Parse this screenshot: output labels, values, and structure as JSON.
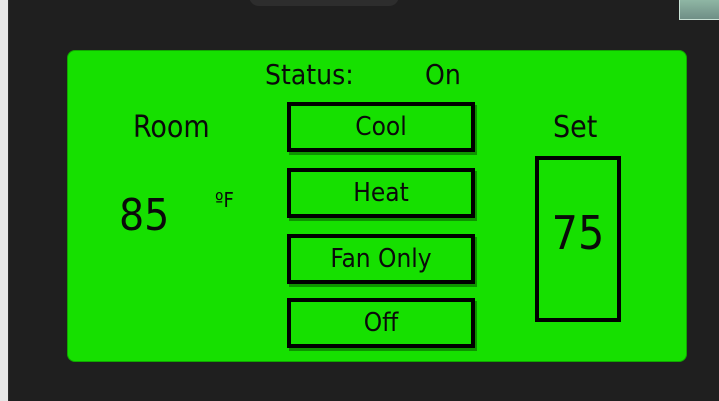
{
  "thermostat": {
    "status_label": "Status:",
    "status_value": "On",
    "room_label": "Room",
    "room_temp": "85",
    "room_unit": "ºF",
    "set_label": "Set",
    "set_value": "75",
    "modes": [
      {
        "label": "Cool"
      },
      {
        "label": "Heat"
      },
      {
        "label": "Fan Only"
      },
      {
        "label": "Off"
      }
    ]
  },
  "colors": {
    "screen_bg": "#16e000",
    "bezel_bg": "#1f1f1f",
    "text": "#0a0a0a",
    "border": "#000000"
  },
  "icons": {
    "corner_tab": "window-tab-icon"
  }
}
